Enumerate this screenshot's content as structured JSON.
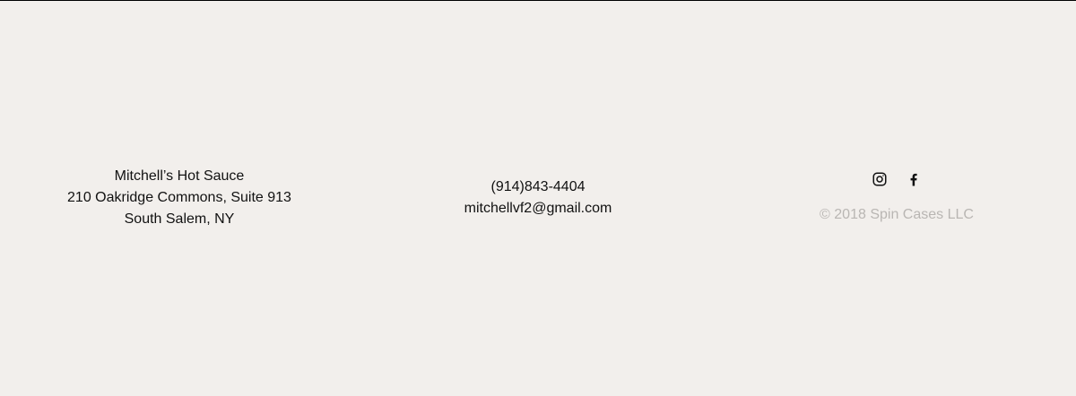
{
  "footer": {
    "address": {
      "name": "Mitchell’s Hot Sauce",
      "street": "210 Oakridge Commons, Suite 913",
      "city": "South Salem, NY"
    },
    "contact": {
      "phone": "(914)843-4404",
      "email": "mitchellvf2@gmail.com"
    },
    "social": {
      "icons": [
        "instagram-icon",
        "facebook-icon"
      ]
    },
    "copyright": "© 2018 Spin Cases LLC"
  },
  "colors": {
    "background": "#f2efec",
    "text": "#111111",
    "muted": "#b9b6b3",
    "top_rule": "#000000"
  }
}
